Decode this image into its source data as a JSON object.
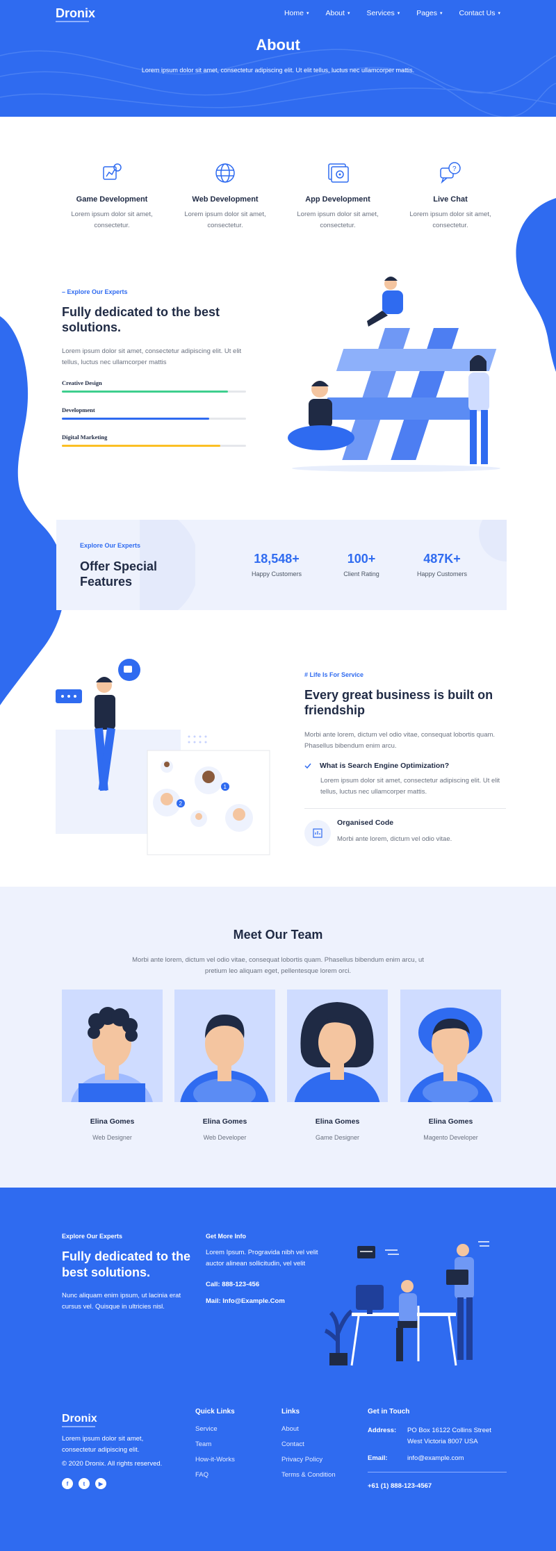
{
  "brand": {
    "name": "Dronix"
  },
  "nav": {
    "items": [
      {
        "label": "Home",
        "caret": "▾"
      },
      {
        "label": "About",
        "caret": "▾"
      },
      {
        "label": "Services",
        "caret": "▾"
      },
      {
        "label": "Pages",
        "caret": "▾"
      },
      {
        "label": "Contact Us",
        "caret": "▾"
      }
    ]
  },
  "hero": {
    "title": "About",
    "subtitle": "Lorem ipsum dolor sit amet, consectetur adipiscing elit. Ut elit tellus, luctus nec ullamcorper mattis."
  },
  "services": [
    {
      "title": "Game Development",
      "text": "Lorem ipsum dolor sit amet, consectetur.",
      "icon": "game-development-icon"
    },
    {
      "title": "Web Development",
      "text": "Lorem ipsum dolor sit amet, consectetur.",
      "icon": "globe-icon"
    },
    {
      "title": "App Development",
      "text": "Lorem ipsum dolor sit amet, consectetur.",
      "icon": "app-settings-icon"
    },
    {
      "title": "Live Chat",
      "text": "Lorem ipsum dolor sit amet, consectetur.",
      "icon": "chat-help-icon"
    }
  ],
  "experts": {
    "kicker": "– Explore Our Experts",
    "title": "Fully dedicated to the best solutions.",
    "text": "Lorem ipsum dolor sit amet, consectetur adipiscing elit. Ut elit tellus, luctus nec ullamcorper mattis",
    "skills": [
      {
        "label": "Creative Design",
        "percent": 90,
        "color": "#3ecf8e"
      },
      {
        "label": "Development",
        "percent": 80,
        "color": "#2f6bf0"
      },
      {
        "label": "Digital Marketing",
        "percent": 86,
        "color": "#fbbf24"
      }
    ]
  },
  "stats": {
    "kicker": "Explore Our Experts",
    "title": "Offer Special Features",
    "items": [
      {
        "number": "18,548+",
        "caption": "Happy Customers"
      },
      {
        "number": "100+",
        "caption": "Client Rating"
      },
      {
        "number": "487K+",
        "caption": "Happy Customers"
      }
    ]
  },
  "business": {
    "kicker": "# Life Is For Service",
    "title": "Every great business is built on friendship",
    "text": "Morbi ante lorem, dictum vel odio vitae, consequat lobortis quam. Phasellus bibendum enim arcu.",
    "faq_question": "What is Search Engine Optimization?",
    "faq_answer": "Lorem ipsum dolor sit amet, consectetur adipiscing elit. Ut elit tellus, luctus nec ullamcorper mattis.",
    "feature_title": "Organised Code",
    "feature_text": "Morbi ante lorem, dictum vel odio vitae.",
    "badges": [
      "1",
      "2"
    ]
  },
  "team": {
    "title": "Meet Our Team",
    "text": "Morbi ante lorem, dictum vel odio vitae, consequat lobortis quam. Phasellus bibendum enim arcu, ut pretium leo aliquam eget, pellentesque lorem orci.",
    "members": [
      {
        "name": "Elina Gomes",
        "role": "Web Designer"
      },
      {
        "name": "Elina Gomes",
        "role": "Web Developer"
      },
      {
        "name": "Elina Gomes",
        "role": "Game Designer"
      },
      {
        "name": "Elina Gomes",
        "role": "Magento Developer"
      }
    ]
  },
  "footer_cta": {
    "kicker": "Explore Our Experts",
    "title": "Fully dedicated to the best solutions.",
    "text": "Nunc aliquam enim ipsum, ut lacinia erat cursus vel. Quisque in ultricies nisl.",
    "info_title": "Get More Info",
    "info_text": "Lorem Ipsum. Progravida nibh vel velit auctor alinean sollicitudin, vel velit",
    "call": "Call: 888-123-456",
    "mail": "Mail: Info@Example.Com"
  },
  "footer": {
    "brand": "Dronix",
    "about": "Lorem ipsum dolor sit amet, consectetur adipiscing elit.",
    "copyright": "© 2020 Dronix. All rights reserved.",
    "quick_title": "Quick Links",
    "quick_links": [
      "Service",
      "Team",
      "How-it-Works",
      "FAQ"
    ],
    "links_title": "Links",
    "links": [
      "About",
      "Contact",
      "Privacy Policy",
      "Terms & Condition"
    ],
    "contact_title": "Get in Touch",
    "address_label": "Address:",
    "address": "PO Box 16122 Collins Street West Victoria 8007 USA",
    "email_label": "Email:",
    "email": "info@example.com",
    "phone": "+61 (1) 888-123-4567",
    "social": [
      "f",
      "t",
      "▶"
    ]
  },
  "colors": {
    "primary": "#2f6bf0",
    "light": "#eef2fd",
    "dark": "#1f2a44"
  }
}
